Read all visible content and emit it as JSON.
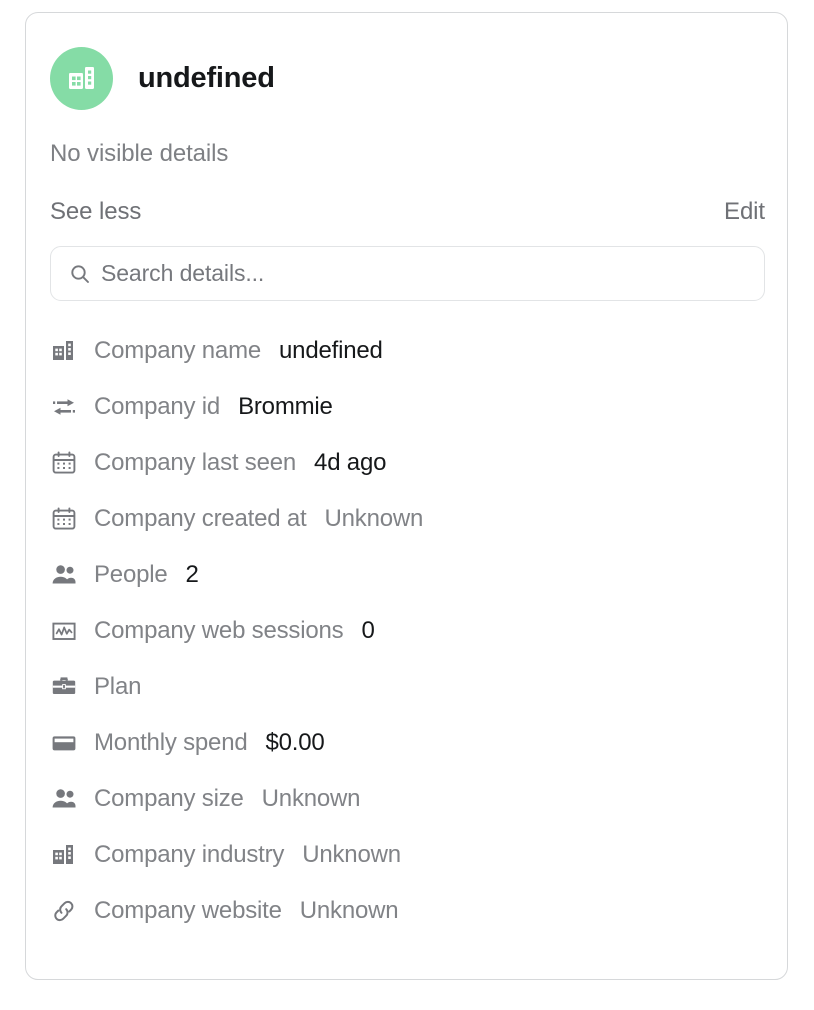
{
  "card": {
    "avatar_icon": "building-icon",
    "avatar_color": "#85dca6",
    "title": "undefined",
    "subtitle": "No visible details",
    "see_less_label": "See less",
    "edit_label": "Edit"
  },
  "search": {
    "icon": "search-icon",
    "placeholder": "Search details...",
    "value": ""
  },
  "details": [
    {
      "icon": "building-icon",
      "label": "Company name",
      "value": "undefined",
      "muted": false
    },
    {
      "icon": "transfer-icon",
      "label": "Company id",
      "value": "Brommie",
      "muted": false
    },
    {
      "icon": "calendar-icon",
      "label": "Company last seen",
      "value": "4d ago",
      "muted": false
    },
    {
      "icon": "calendar-icon",
      "label": "Company created at",
      "value": "Unknown",
      "muted": true
    },
    {
      "icon": "people-icon",
      "label": "People",
      "value": "2",
      "muted": false
    },
    {
      "icon": "chart-box-icon",
      "label": "Company web sessions",
      "value": "0",
      "muted": false
    },
    {
      "icon": "briefcase-icon",
      "label": "Plan",
      "value": "",
      "muted": false
    },
    {
      "icon": "credit-card-icon",
      "label": "Monthly spend",
      "value": "$0.00",
      "muted": false
    },
    {
      "icon": "people-icon",
      "label": "Company size",
      "value": "Unknown",
      "muted": true
    },
    {
      "icon": "building-icon",
      "label": "Company industry",
      "value": "Unknown",
      "muted": true
    },
    {
      "icon": "link-icon",
      "label": "Company website",
      "value": "Unknown",
      "muted": true
    }
  ]
}
